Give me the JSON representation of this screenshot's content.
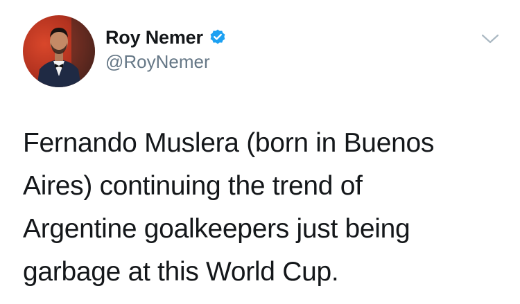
{
  "author": {
    "display_name": "Roy Nemer",
    "handle": "@RoyNemer",
    "verified": true,
    "avatar_icon": "profile-photo",
    "verified_icon": "verified-badge-icon"
  },
  "controls": {
    "menu_icon": "chevron-down-icon"
  },
  "tweet": {
    "text": "Fernando Muslera (born in Buenos\nAires) continuing the trend of\nArgentine goalkeepers just being\ngarbage at this World Cup."
  },
  "colors": {
    "name": "#14171a",
    "handle": "#657786",
    "verified": "#1da1f2",
    "caret": "#aab8c2"
  }
}
